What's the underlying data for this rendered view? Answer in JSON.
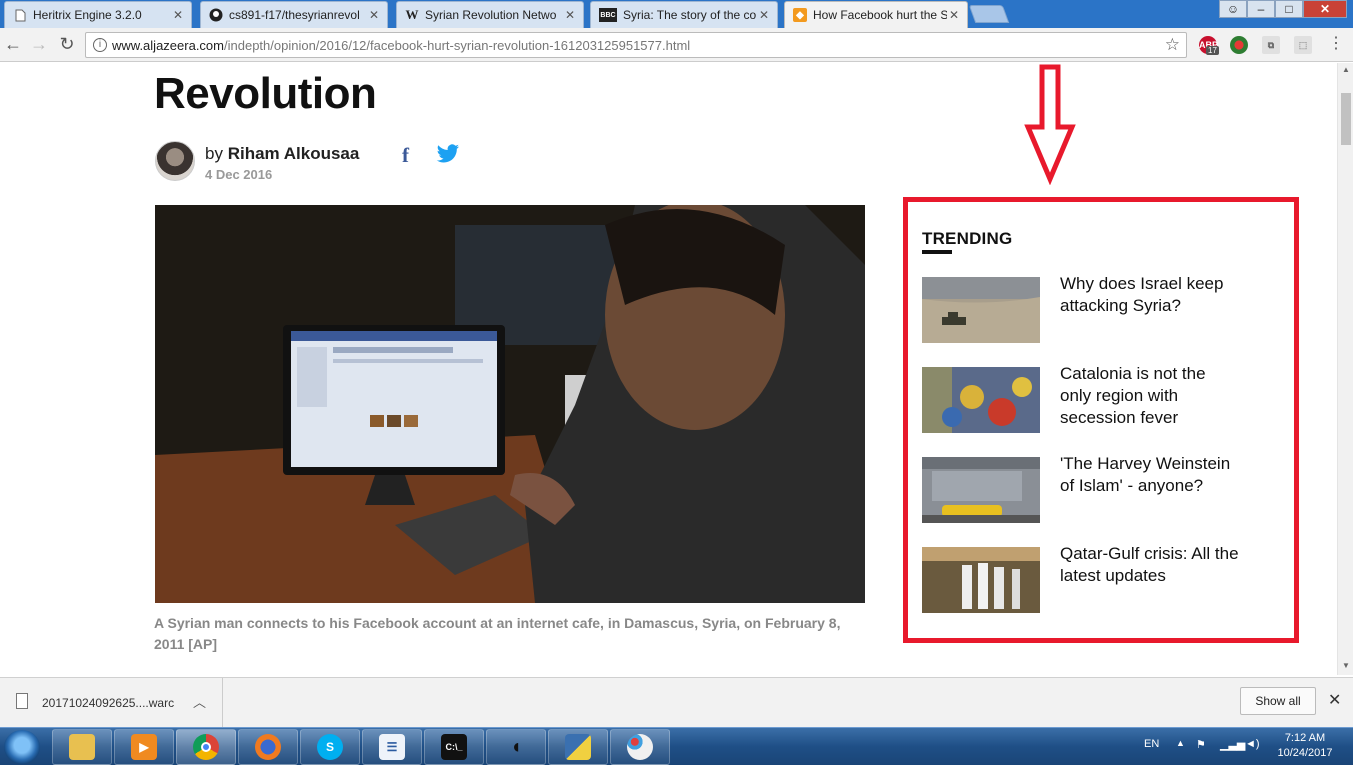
{
  "browser": {
    "tabs": [
      {
        "title": "Heritrix Engine 3.2.0",
        "icon": "page-icon",
        "active": false
      },
      {
        "title": "cs891-f17/thesyrianrevol",
        "icon": "github-icon",
        "active": false
      },
      {
        "title": "Syrian Revolution Netwo",
        "icon": "wikipedia-icon",
        "active": false
      },
      {
        "title": "Syria: The story of the co",
        "icon": "bbc-icon",
        "active": false
      },
      {
        "title": "How Facebook hurt the S",
        "icon": "aljazeera-icon",
        "active": true
      }
    ],
    "url_host": "www.aljazeera.com",
    "url_path": "/indepth/opinion/2016/12/facebook-hurt-syrian-revolution-161203125951577.html",
    "ext_badge": "17"
  },
  "article": {
    "headline": "Revolution",
    "by_prefix": "by",
    "author": "Riham Alkousaa",
    "date": "4 Dec 2016",
    "facebook_glyph": "f",
    "caption": "A Syrian man connects to his Facebook account at an internet cafe, in Damascus, Syria, on February 8, 2011 [AP]"
  },
  "trending": {
    "title": "TRENDING",
    "items": [
      {
        "text": "Why does Israel keep attacking Syria?"
      },
      {
        "text": "Catalonia is not the only region with secession fever"
      },
      {
        "text": "'The Harvey Weinstein of Islam' - anyone?"
      },
      {
        "text": "Qatar-Gulf crisis: All the latest updates"
      }
    ]
  },
  "annotation": {
    "color": "#e8192c"
  },
  "downloads": {
    "filename": "20171024092625....warc",
    "show_all": "Show all"
  },
  "taskbar": {
    "language": "EN",
    "time": "7:12 AM",
    "date": "10/24/2017"
  }
}
